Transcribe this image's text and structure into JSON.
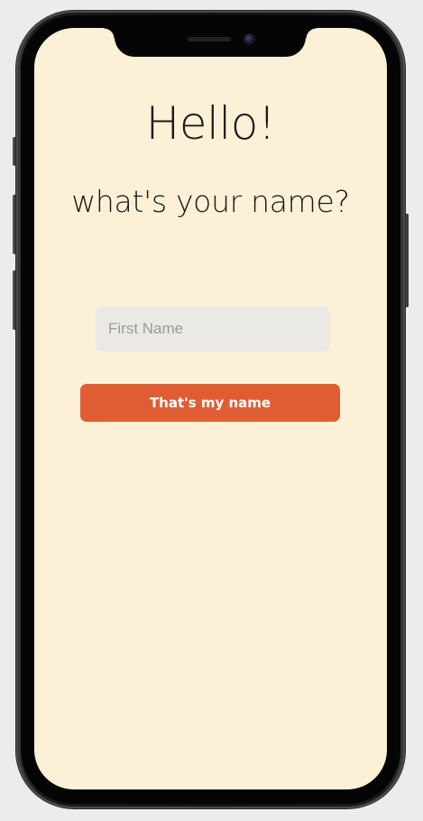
{
  "screen": {
    "greeting": "Hello!",
    "question": "what's your name?"
  },
  "form": {
    "first_name": {
      "value": "",
      "placeholder": "First Name"
    },
    "submit_label": "That's my name"
  },
  "colors": {
    "screen_background": "#fcf1d6",
    "input_background": "#ebe9e6",
    "button_accent": "#e05d33",
    "button_text": "#ffffff",
    "heading_text": "#1a1a1a"
  }
}
